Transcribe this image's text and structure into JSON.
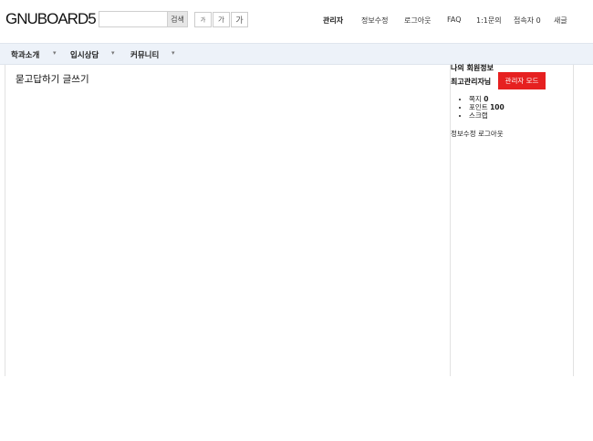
{
  "header": {
    "logo": "GNUBOARD5",
    "search": {
      "placeholder": "",
      "value": "",
      "button_label": "검색"
    },
    "font_size_buttons": [
      "가",
      "가",
      "가"
    ],
    "nav": [
      "관리자",
      "정보수정",
      "로그아웃",
      "FAQ",
      "1:1문의",
      "접속자 0",
      "새글"
    ]
  },
  "gnb": {
    "items": [
      "학과소개",
      "입시상담",
      "커뮤니티"
    ],
    "caret": "▾"
  },
  "main": {
    "title": "묻고답하기 글쓰기"
  },
  "aside": {
    "title": "나의 회원정보",
    "member_name": "최고관리자님",
    "admin_button": "관리자 모드",
    "stats": [
      {
        "label": "쪽지",
        "value": "0"
      },
      {
        "label": "포인트",
        "value": "100"
      },
      {
        "label": "스크랩",
        "value": ""
      }
    ],
    "link_edit": "정보수정",
    "link_logout": "로그아웃"
  },
  "colors": {
    "gnb_bg": "#edf2f9",
    "admin_button": "#e62020"
  }
}
